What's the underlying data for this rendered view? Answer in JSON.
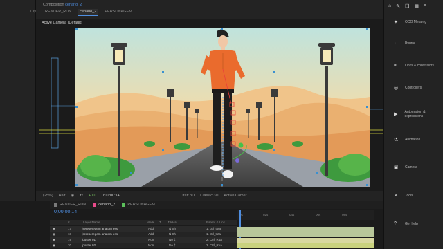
{
  "left_panel": {
    "label": "Lay"
  },
  "left_colors": [
    "#d9a0b8",
    "#e6c84d",
    "#e8a8c0",
    "#8e8fd8",
    "#d6a35a"
  ],
  "composition": {
    "title_prefix": "Composition",
    "title_name": "cenario_2",
    "tabs": [
      "RENDER_RUN",
      "cenario_2",
      "PERSONAGEM"
    ],
    "active_camera": "Active Camera (Default)"
  },
  "viewer_bar": {
    "zoom": "(25%)",
    "resolution": "Half",
    "exposure": "+0.0",
    "timecode": "0:00:00:14",
    "renderer": "Draft 3D",
    "renderer_mode": "Classic 3D",
    "camera": "Active Camer..."
  },
  "right_panel": {
    "top_icons": [
      "home-icon",
      "pen-icon",
      "layers-icon",
      "grid-icon",
      "menu-icon"
    ],
    "items": [
      {
        "label": "OCO Meta-rig",
        "icon": "rig-icon"
      },
      {
        "label": "Bones",
        "icon": "bone-icon"
      },
      {
        "label": "Links & constraints",
        "icon": "link-icon"
      },
      {
        "label": "Controllers",
        "icon": "controller-icon"
      },
      {
        "label": "Automation & expressions",
        "icon": "play-icon"
      },
      {
        "label": "Animation",
        "icon": "animation-icon"
      },
      {
        "label": "Camera",
        "icon": "camera-icon"
      },
      {
        "label": "Tools",
        "icon": "tools-icon"
      },
      {
        "label": "Get help",
        "icon": "help-icon"
      }
    ]
  },
  "timeline": {
    "tabs": [
      {
        "label": "RENDER_RUN",
        "color": "#7a7a7a"
      },
      {
        "label": "cenario_2",
        "color": "#e84a8a"
      },
      {
        "label": "PERSONAGEM",
        "color": "#5bbf5b"
      }
    ],
    "current_time": "0;00;00;14",
    "columns": [
      "#",
      "Layer Name",
      "Mode",
      "T",
      "TrkMat",
      "Parent & Link"
    ],
    "rows": [
      {
        "num": "17",
        "name": "[sereseregem anatom ess]",
        "mode": "Add",
        "trk": "Ñ Sh",
        "parent": "1. ctrl_total"
      },
      {
        "num": "18",
        "name": "[sereseregem anatom ess]",
        "mode": "Add",
        "trk": "Ñ Sh",
        "parent": "1. ctrl_total"
      },
      {
        "num": "19",
        "name": "[poster 01]",
        "mode": "Norr",
        "trk": "No ‡",
        "parent": "2. Ctrl_Rua"
      },
      {
        "num": "20",
        "name": "[poster 02]",
        "mode": "Norr",
        "trk": "No ‡",
        "parent": "2. Ctrl_Rua"
      }
    ],
    "ruler_labels": [
      "0s",
      "02s",
      "04s",
      "06s",
      "08s"
    ],
    "bar_colors": [
      "#b8c79a",
      "#b8c79a",
      "#d8d8a0",
      "#c9d27e"
    ]
  }
}
